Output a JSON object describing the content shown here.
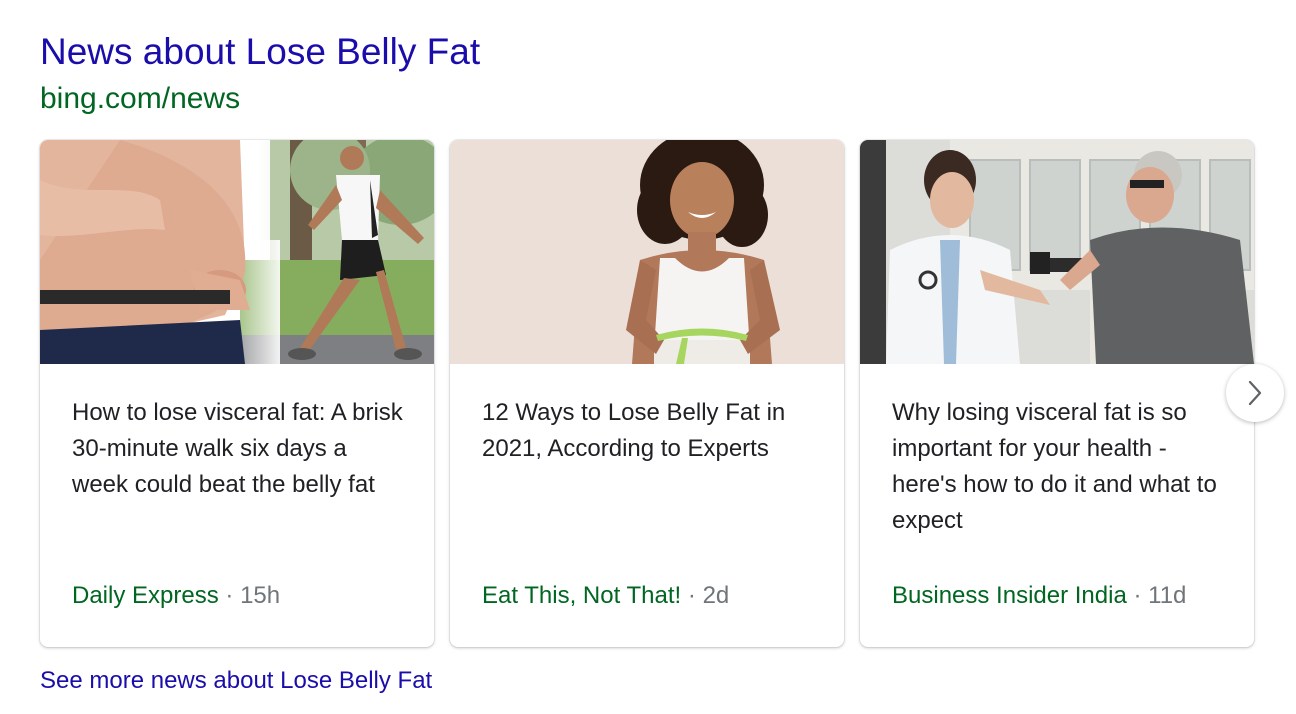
{
  "header": {
    "title": "News about Lose Belly Fat",
    "source": "bing.com/news"
  },
  "cards": [
    {
      "title": "How to lose visceral fat: A brisk 30-minute walk six days a week could beat the belly fat",
      "publisher": "Daily Express",
      "separator": "·",
      "age": "15h"
    },
    {
      "title": "12 Ways to Lose Belly Fat in 2021, According to Experts",
      "publisher": "Eat This, Not That!",
      "separator": "·",
      "age": "2d"
    },
    {
      "title": "Why losing visceral fat is so important for your health - here's how to do it and what to expect",
      "publisher": "Business Insider India",
      "separator": "·",
      "age": "11d"
    }
  ],
  "carousel": {
    "next_icon": "chevron-right-icon"
  },
  "footer": {
    "more_link": "See more news about Lose Belly Fat"
  },
  "colors": {
    "link": "#1a0dab",
    "url_green": "#006621",
    "meta_gray": "#70757a",
    "text": "#202124"
  }
}
